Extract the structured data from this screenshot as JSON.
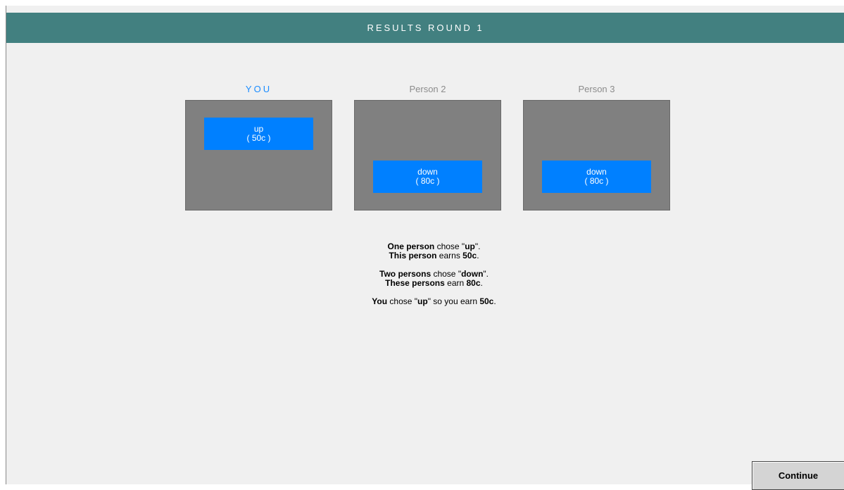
{
  "header": {
    "title": "RESULTS ROUND 1"
  },
  "colors": {
    "header_bg": "#428080",
    "choice_bg": "#0080ff",
    "panel_bg": "#808080",
    "you_label": "#1a8cff"
  },
  "players": [
    {
      "label": "YOU",
      "choice": "up",
      "amount": "( 50c )"
    },
    {
      "label": "Person 2",
      "choice": "down",
      "amount": "( 80c )"
    },
    {
      "label": "Person 3",
      "choice": "down",
      "amount": "( 80c )"
    }
  ],
  "summary": {
    "line1": {
      "bold": "One person",
      "mid": " chose \"",
      "choice": "up",
      "end": "\"."
    },
    "line2": {
      "bold": "This person",
      "mid": " earns ",
      "amount": "50c",
      "end": "."
    },
    "line3": {
      "bold": "Two persons",
      "mid": " chose \"",
      "choice": "down",
      "end": "\"."
    },
    "line4": {
      "bold": "These persons",
      "mid": " earn ",
      "amount": "80c",
      "end": "."
    },
    "line5": {
      "bold": "You",
      "mid": " chose \"",
      "choice": "up",
      "mid2": "\" so you earn ",
      "amount": "50c",
      "end": "."
    }
  },
  "actions": {
    "continue_label": "Continue"
  }
}
